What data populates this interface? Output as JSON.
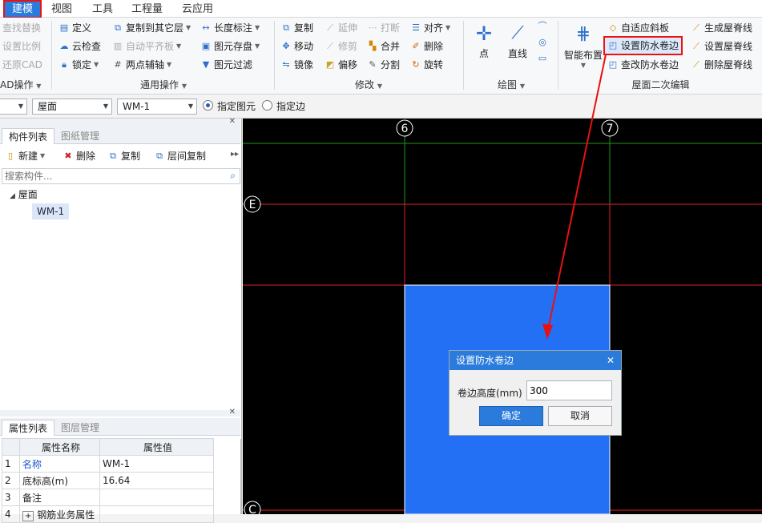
{
  "menu": {
    "tabs": [
      {
        "label": "建模",
        "active": true
      },
      {
        "label": "视图",
        "active": false
      },
      {
        "label": "工具",
        "active": false
      },
      {
        "label": "工程量",
        "active": false
      },
      {
        "label": "云应用",
        "active": false
      }
    ]
  },
  "ribbon": {
    "cad_ops": {
      "items": [
        "查找替换",
        "设置比例",
        "还原CAD"
      ],
      "group_label": "AD操作"
    },
    "common_ops": {
      "define": "定义",
      "cloud_check": "云检查",
      "lock": "锁定",
      "copy_to_floor": "复制到其它层",
      "auto_flat": "自动平齐板",
      "two_point_axis": "两点辅轴",
      "length_mark": "长度标注",
      "element_store": "图元存盘",
      "element_filter": "图元过滤",
      "group_label": "通用操作"
    },
    "modify": {
      "copy": "复制",
      "move": "移动",
      "mirror": "镜像",
      "extend": "延伸",
      "trim": "修剪",
      "offset": "偏移",
      "break": "打断",
      "merge": "合并",
      "split": "分割",
      "align": "对齐",
      "delete": "删除",
      "rotate": "旋转",
      "group_label": "修改"
    },
    "draw": {
      "point": "点",
      "line": "直线",
      "group_label": "绘图"
    },
    "roof_edit": {
      "smart_layout": "智能布置",
      "adaptive_slope": "自适应斜板",
      "set_waterproof": "设置防水卷边",
      "query_waterproof": "查改防水卷边",
      "gen_ridge": "生成屋脊线",
      "set_ridge": "设置屋脊线",
      "del_ridge": "删除屋脊线",
      "group_label": "屋面二次编辑"
    }
  },
  "toolbar": {
    "floor_combo": "",
    "type_combo": "屋面",
    "element_combo": "WM-1",
    "radio_element": "指定图元",
    "radio_edge": "指定边",
    "radio_selected": "element"
  },
  "component_panel": {
    "tabs": [
      "构件列表",
      "图纸管理"
    ],
    "actions": {
      "new": "新建",
      "delete": "删除",
      "copy": "复制",
      "floor_copy": "层间复制"
    },
    "search_placeholder": "搜索构件...",
    "tree": {
      "root": "屋面",
      "child": "WM-1"
    }
  },
  "property_panel": {
    "tabs": [
      "属性列表",
      "图层管理"
    ],
    "headers": {
      "name": "属性名称",
      "value": "属性值"
    },
    "rows": [
      {
        "index": "1",
        "name": "名称",
        "value": "WM-1"
      },
      {
        "index": "2",
        "name": "底标高(m)",
        "value": "16.64"
      },
      {
        "index": "3",
        "name": "备注",
        "value": ""
      },
      {
        "index": "4",
        "name": "钢筋业务属性",
        "value": ""
      }
    ]
  },
  "canvas": {
    "axis_labels": {
      "axis_6": "6",
      "axis_7": "7",
      "axis_E": "E",
      "axis_C": "C"
    },
    "colors": {
      "background": "#000000",
      "grid_red": "#e02020",
      "grid_green": "#1a9a1a",
      "roof": "#2470f5",
      "arrow": "#e81010"
    }
  },
  "dialog": {
    "title": "设置防水卷边",
    "field_label": "卷边高度(mm)",
    "field_value": "300",
    "ok": "确定",
    "cancel": "取消"
  }
}
